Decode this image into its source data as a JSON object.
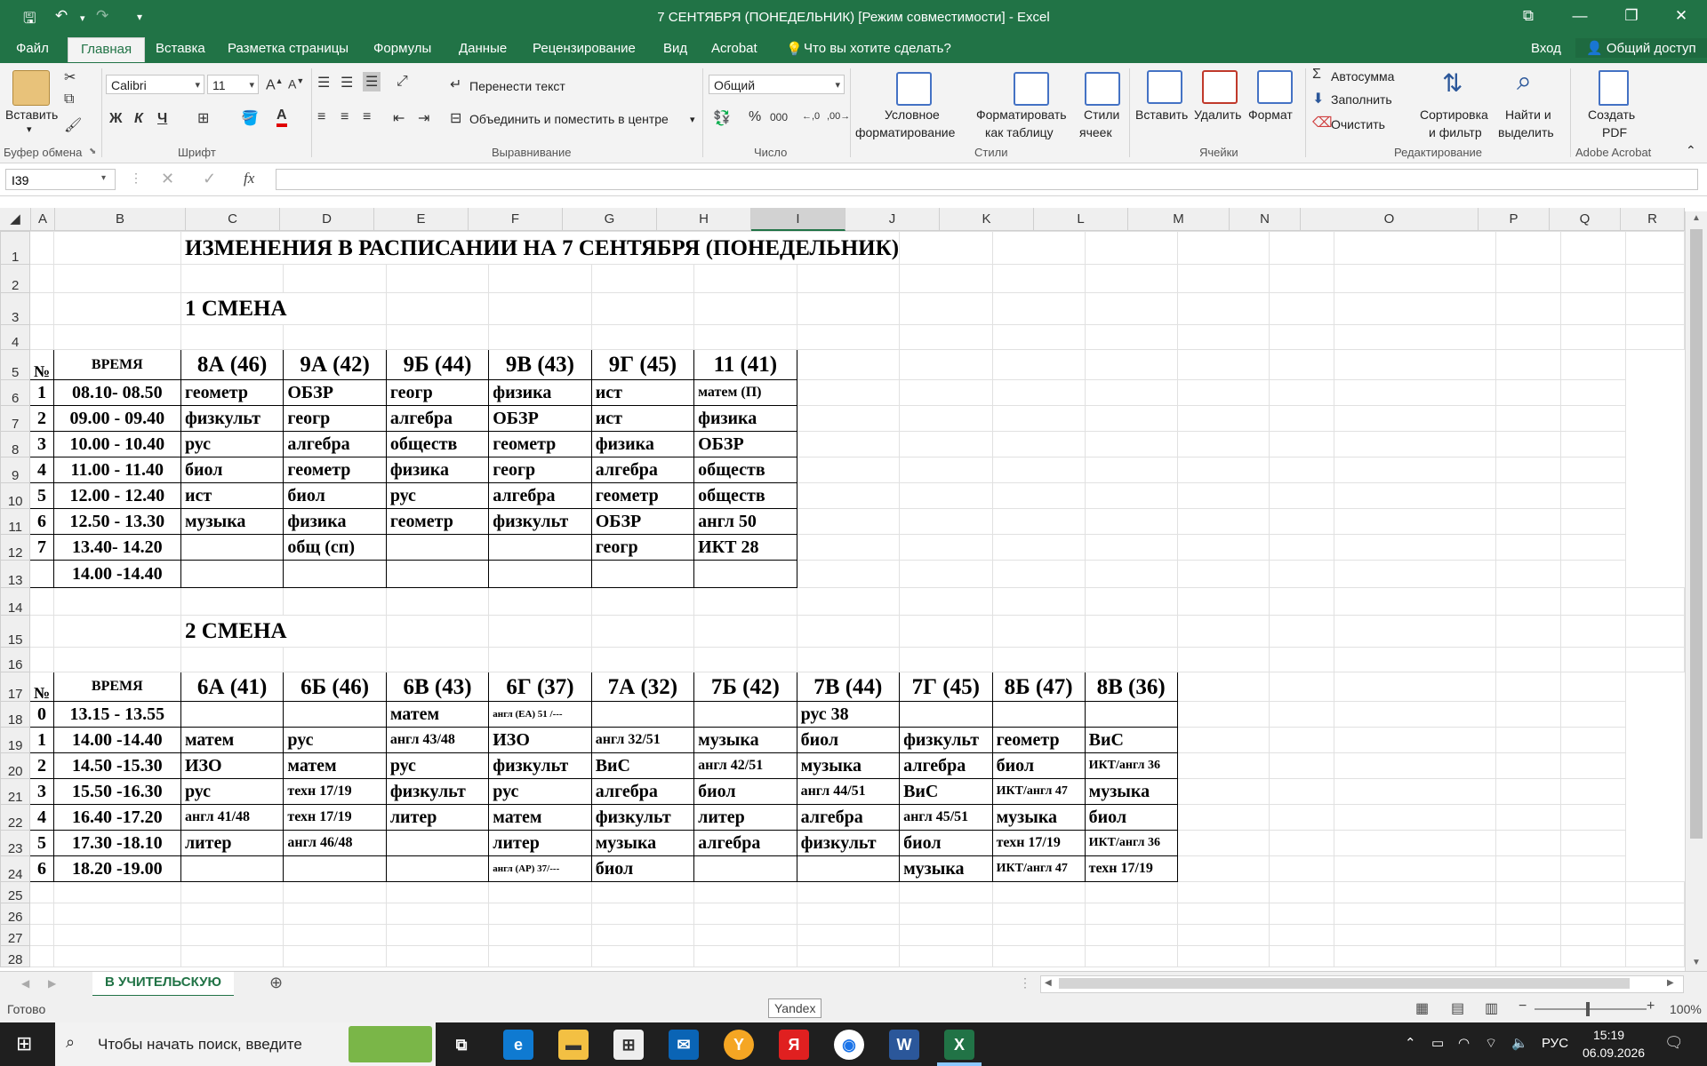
{
  "window": {
    "title": "7 СЕНТЯБРЯ (ПОНЕДЕЛЬНИК)  [Режим совместимости] - Excel",
    "login": "Вход",
    "share": "Общий доступ"
  },
  "menu_tabs": [
    "Файл",
    "Главная",
    "Вставка",
    "Разметка страницы",
    "Формулы",
    "Данные",
    "Рецензирование",
    "Вид",
    "Acrobat"
  ],
  "tell_me": "Что вы хотите сделать?",
  "ribbon": {
    "paste": "Вставить",
    "clipboard_group": "Буфер обмена",
    "font_name": "Calibri",
    "font_size": "11",
    "font_group": "Шрифт",
    "bold": "Ж",
    "italic": "К",
    "underline": "Ч",
    "wrap_text": "Перенести текст",
    "merge_center": "Объединить и поместить в центре",
    "alignment_group": "Выравнивание",
    "number_format": "Общий",
    "number_group": "Число",
    "cond_format_1": "Условное",
    "cond_format_2": "форматирование",
    "format_table_1": "Форматировать",
    "format_table_2": "как таблицу",
    "cell_styles_1": "Стили",
    "cell_styles_2": "ячеек",
    "styles_group": "Стили",
    "insert": "Вставить",
    "delete": "Удалить",
    "format": "Формат",
    "cells_group": "Ячейки",
    "autosum": "Автосумма",
    "fill": "Заполнить",
    "clear": "Очистить",
    "sort_1": "Сортировка",
    "sort_2": "и фильтр",
    "find_1": "Найти и",
    "find_2": "выделить",
    "editing_group": "Редактирование",
    "pdf_1": "Создать",
    "pdf_2": "PDF",
    "acrobat_group": "Adobe Acrobat"
  },
  "formula_bar": {
    "name_box": "I39",
    "fx": "fx",
    "value": ""
  },
  "columns": [
    "A",
    "B",
    "C",
    "D",
    "E",
    "F",
    "G",
    "H",
    "I",
    "J",
    "K",
    "L",
    "M",
    "N",
    "O",
    "P",
    "Q",
    "R"
  ],
  "sheet": {
    "title": "ИЗМЕНЕНИЯ В РАСПИСАНИИ НА 7 СЕНТЯБРЯ (ПОНЕДЕЛЬНИК)",
    "shift1_label": "1 СМЕНА",
    "shift2_label": "2 СМЕНА",
    "num_header": "№",
    "time_header": "ВРЕМЯ",
    "shift1_classes": [
      "8А (46)",
      "9А (42)",
      "9Б (44)",
      "9В (43)",
      "9Г (45)",
      "11 (41)"
    ],
    "shift1_rows": [
      {
        "n": "1",
        "time": "08.10- 08.50",
        "cells": [
          "геометр",
          "ОБЗР",
          "геогр",
          "физика",
          "ист",
          "матем (П)"
        ]
      },
      {
        "n": "2",
        "time": "09.00 - 09.40",
        "cells": [
          "физкульт",
          "геогр",
          "алгебра",
          "ОБЗР",
          "ист",
          "физика"
        ]
      },
      {
        "n": "3",
        "time": "10.00 - 10.40",
        "cells": [
          "рус",
          "алгебра",
          "обществ",
          "геометр",
          "физика",
          "ОБЗР"
        ]
      },
      {
        "n": "4",
        "time": "11.00 - 11.40",
        "cells": [
          "биол",
          "геометр",
          "физика",
          "геогр",
          "алгебра",
          "обществ"
        ]
      },
      {
        "n": "5",
        "time": "12.00 - 12.40",
        "cells": [
          "ист",
          "биол",
          "рус",
          "алгебра",
          "геометр",
          "обществ"
        ]
      },
      {
        "n": "6",
        "time": "12.50 - 13.30",
        "cells": [
          "музыка",
          "физика",
          "геометр",
          "физкульт",
          "ОБЗР",
          "англ 50"
        ]
      },
      {
        "n": "7",
        "time": "13.40- 14.20",
        "cells": [
          "",
          "общ (сп)",
          "",
          "",
          "геогр",
          "ИКТ 28"
        ]
      },
      {
        "n": "",
        "time": "14.00 -14.40",
        "cells": [
          "",
          "",
          "",
          "",
          "",
          ""
        ]
      }
    ],
    "shift2_classes": [
      "6А (41)",
      "6Б (46)",
      "6В (43)",
      "6Г (37)",
      "7А (32)",
      "7Б (42)",
      "7В (44)",
      "7Г (45)",
      "8Б (47)",
      "8В (36)"
    ],
    "shift2_rows": [
      {
        "n": "0",
        "time": "13.15 - 13.55",
        "cells": [
          "",
          "",
          "матем",
          "англ (ЕА) 51 /---",
          "",
          "",
          "рус 38",
          "",
          "",
          ""
        ]
      },
      {
        "n": "1",
        "time": "14.00 -14.40",
        "cells": [
          "матем",
          "рус",
          "англ 43/48",
          "ИЗО",
          "англ 32/51",
          "музыка",
          "биол",
          "физкульт",
          "геометр",
          "ВиС"
        ]
      },
      {
        "n": "2",
        "time": "14.50 -15.30",
        "cells": [
          "ИЗО",
          "матем",
          "рус",
          "физкульт",
          "ВиС",
          "англ 42/51",
          "музыка",
          "алгебра",
          "биол",
          "ИКТ/англ 36"
        ]
      },
      {
        "n": "3",
        "time": "15.50 -16.30",
        "cells": [
          "рус",
          "техн 17/19",
          "физкульт",
          "рус",
          "алгебра",
          "биол",
          "англ 44/51",
          "ВиС",
          "ИКТ/англ 47",
          "музыка"
        ]
      },
      {
        "n": "4",
        "time": "16.40 -17.20",
        "cells": [
          "англ 41/48",
          "техн 17/19",
          "литер",
          "матем",
          "физкульт",
          "литер",
          "алгебра",
          "англ 45/51",
          "музыка",
          "биол"
        ]
      },
      {
        "n": "5",
        "time": "17.30 -18.10",
        "cells": [
          "литер",
          "англ 46/48",
          "",
          "литер",
          "музыка",
          "алгебра",
          "физкульт",
          "биол",
          "техн 17/19",
          "ИКТ/англ 36"
        ]
      },
      {
        "n": "6",
        "time": "18.20 -19.00",
        "cells": [
          "",
          "",
          "",
          "англ (АР) 37/---",
          "биол",
          "",
          "",
          "музыка",
          "ИКТ/англ 47",
          "техн 17/19"
        ]
      }
    ]
  },
  "sheet_tab": "В УЧИТЕЛЬСКУЮ",
  "status": {
    "ready": "Готово",
    "zoom": "100%",
    "tooltip": "Yandex"
  },
  "taskbar": {
    "search_placeholder": "Чтобы начать поиск, введите",
    "lang": "РУС",
    "time": "15:19",
    "date": "06.09.2026"
  },
  "colors": {
    "excel_green": "#217346",
    "ribbon_bg": "#f3f3f3",
    "taskbar": "#1f1f1f"
  }
}
